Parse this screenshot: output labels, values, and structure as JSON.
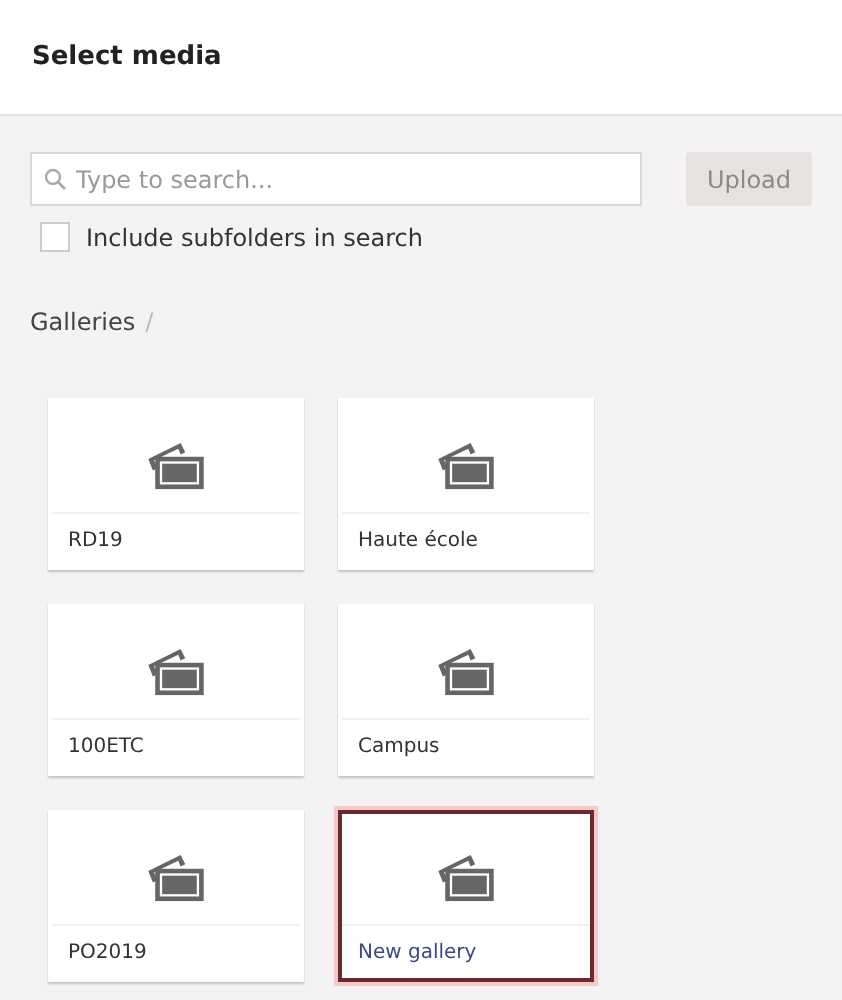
{
  "header": {
    "title": "Select media"
  },
  "search": {
    "placeholder": "Type to search..."
  },
  "upload_button": {
    "label": "Upload",
    "disabled": true
  },
  "include_subfolders": {
    "label": "Include subfolders in search",
    "checked": false
  },
  "breadcrumb": {
    "items": [
      "Galleries"
    ],
    "separator": "/"
  },
  "folders": [
    {
      "name": "RD19",
      "selected": false
    },
    {
      "name": "Haute école",
      "selected": false
    },
    {
      "name": "100ETC",
      "selected": false
    },
    {
      "name": "Campus",
      "selected": false
    },
    {
      "name": "PO2019",
      "selected": false
    },
    {
      "name": "New gallery",
      "selected": true
    }
  ]
}
